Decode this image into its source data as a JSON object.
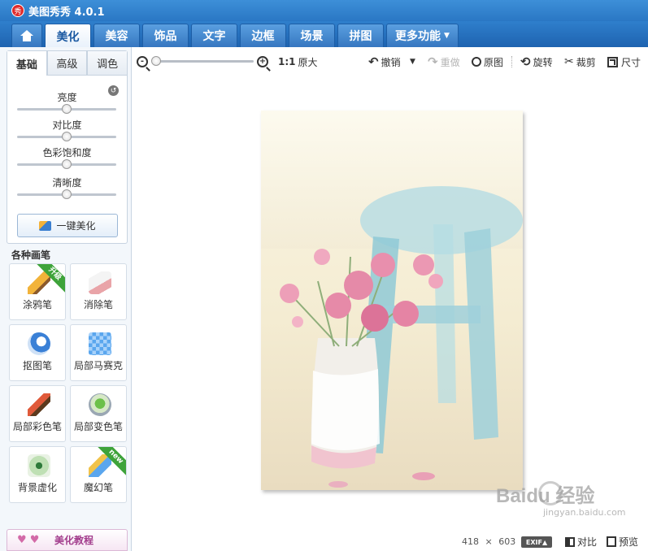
{
  "app": {
    "logo_char": "秀",
    "title": "美图秀秀 4.0.1"
  },
  "tabs": [
    {
      "label": "美化",
      "active": true
    },
    {
      "label": "美容"
    },
    {
      "label": "饰品"
    },
    {
      "label": "文字"
    },
    {
      "label": "边框"
    },
    {
      "label": "场景"
    },
    {
      "label": "拼图"
    },
    {
      "label": "更多功能"
    }
  ],
  "adjust": {
    "subtabs": [
      "基础",
      "高级",
      "调色"
    ],
    "sliders": [
      {
        "label": "亮度",
        "level": 0.5
      },
      {
        "label": "对比度",
        "level": 0.5
      },
      {
        "label": "色彩饱和度",
        "level": 0.5
      },
      {
        "label": "清晰度",
        "level": 0.5
      }
    ],
    "onekey_label": "一键美化"
  },
  "brushes": {
    "title": "各种画笔",
    "items": [
      {
        "label": "涂鸦笔",
        "icon": "brush-icon",
        "badge": "升级"
      },
      {
        "label": "消除笔",
        "icon": "eraser-icon"
      },
      {
        "label": "抠图笔",
        "icon": "cutout-pen-icon"
      },
      {
        "label": "局部马赛克",
        "icon": "mosaic-icon"
      },
      {
        "label": "局部彩色笔",
        "icon": "color-brush-icon"
      },
      {
        "label": "局部变色笔",
        "icon": "color-bucket-icon"
      },
      {
        "label": "背景虚化",
        "icon": "blur-background-icon"
      },
      {
        "label": "魔幻笔",
        "icon": "magic-wand-icon",
        "badge": "new"
      }
    ]
  },
  "tutorial_label": "美化教程",
  "toolbar": {
    "zoom_ratio": "1:1",
    "zoom_level": 0.0,
    "original_size": "原大",
    "undo": "撤销",
    "redo": "重做",
    "original": "原图",
    "rotate": "旋转",
    "crop": "裁剪",
    "size": "尺寸"
  },
  "status": {
    "width": "418",
    "times": "×",
    "height": "603",
    "exif": "EXIF▲",
    "compare": "对比",
    "preview": "预览"
  },
  "watermark": {
    "text": "Baidu 经验",
    "url": "jingyan.baidu.com"
  }
}
